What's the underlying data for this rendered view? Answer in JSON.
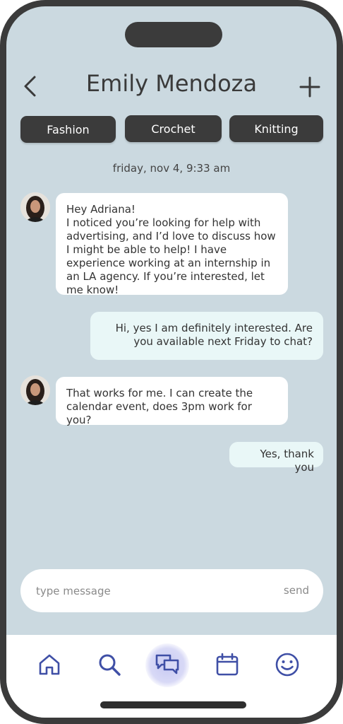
{
  "header": {
    "contact_name": "Emily Mendoza"
  },
  "tags": [
    "Fashion",
    "Crochet",
    "Knitting"
  ],
  "timestamp": "friday, nov 4, 9:33 am",
  "messages": [
    {
      "from": "contact",
      "text": "Hey Adriana!\nI noticed you’re looking for help with advertising, and I’d love to discuss how I might be able to help! I have experience working at an internship in an LA agency. If you’re interested, let me know!"
    },
    {
      "from": "me",
      "text": "Hi, yes I am definitely interested. Are you available next Friday to chat?"
    },
    {
      "from": "contact",
      "text": "That works for me. I can create the calendar event, does 3pm work for you?"
    },
    {
      "from": "me",
      "text": "Yes, thank you"
    }
  ],
  "composer": {
    "placeholder": "type message",
    "value": "",
    "send_label": "send"
  },
  "nav": {
    "items": [
      "home-icon",
      "search-icon",
      "chat-icon",
      "calendar-icon",
      "smiley-icon"
    ],
    "active": "chat-icon",
    "icon_color": "#3f4fa6"
  },
  "colors": {
    "background": "#cbd9e0",
    "frame": "#3b3b3b",
    "received_bubble": "#ffffff",
    "sent_bubble": "#e9f7f7",
    "tag_background": "#3b3b3b",
    "nav_icon": "#3f4fa6"
  }
}
